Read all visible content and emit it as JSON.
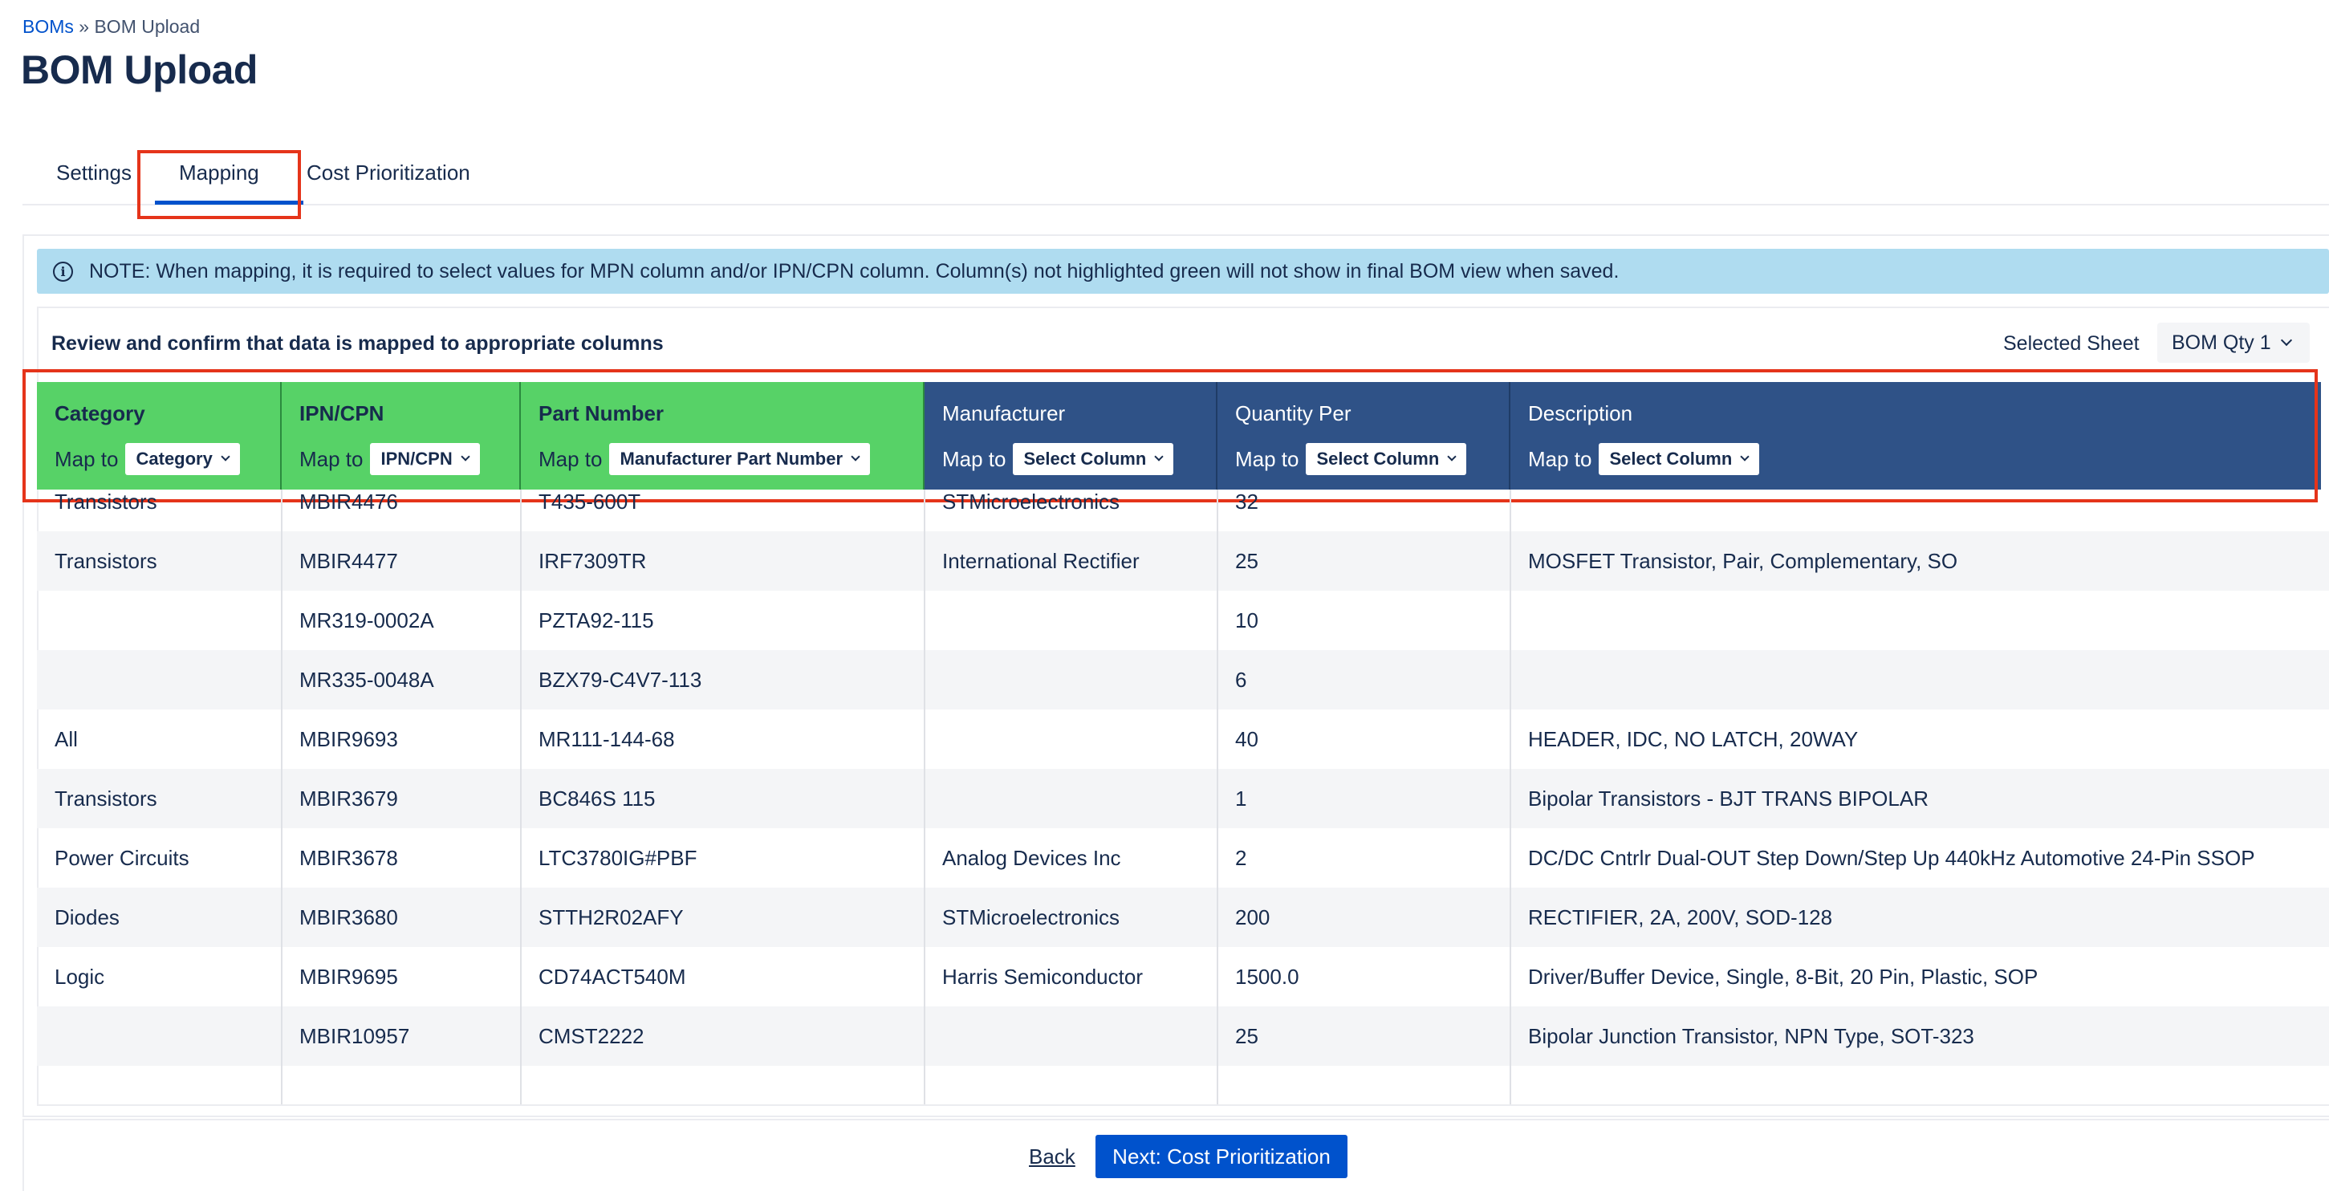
{
  "breadcrumb": {
    "parent": "BOMs",
    "separator": "»",
    "current": "BOM Upload"
  },
  "page_title": "BOM Upload",
  "tabs": [
    {
      "label": "Settings"
    },
    {
      "label": "Mapping",
      "active": true
    },
    {
      "label": "Cost Prioritization"
    }
  ],
  "note": {
    "icon": "info-icon",
    "text": "NOTE: When mapping, it is required to select values for MPN column and/or IPN/CPN column. Column(s) not highlighted green will not show in final BOM view when saved."
  },
  "review_text": "Review and confirm that data is mapped to appropriate columns",
  "sheet": {
    "label": "Selected Sheet",
    "value": "BOM Qty 1"
  },
  "map_to_label": "Map to",
  "columns": [
    {
      "name": "Category",
      "map": "Category",
      "state": "green"
    },
    {
      "name": "IPN/CPN",
      "map": "IPN/CPN",
      "state": "green"
    },
    {
      "name": "Part Number",
      "map": "Manufacturer Part Number",
      "state": "green"
    },
    {
      "name": "Manufacturer",
      "map": "Select Column",
      "state": "blue"
    },
    {
      "name": "Quantity Per",
      "map": "Select Column",
      "state": "blue"
    },
    {
      "name": "Description",
      "map": "Select Column",
      "state": "blue"
    }
  ],
  "rows": [
    [
      "Transistors",
      "MBIR4476",
      "T435-600T",
      "STMicroelectronics",
      "32",
      ""
    ],
    [
      "Transistors",
      "MBIR4477",
      "IRF7309TR",
      "International Rectifier",
      "25",
      "MOSFET Transistor, Pair, Complementary, SO"
    ],
    [
      "",
      "MR319-0002A",
      "PZTA92-115",
      "",
      "10",
      ""
    ],
    [
      "",
      "MR335-0048A",
      "BZX79-C4V7-113",
      "",
      "6",
      ""
    ],
    [
      "All",
      "MBIR9693",
      "MR111-144-68",
      "",
      "40",
      "HEADER, IDC, NO LATCH, 20WAY"
    ],
    [
      "Transistors",
      "MBIR3679",
      "BC846S 115",
      "",
      "1",
      "Bipolar Transistors - BJT TRANS BIPOLAR"
    ],
    [
      "Power Circuits",
      "MBIR3678",
      "LTC3780IG#PBF",
      "Analog Devices Inc",
      "2",
      "DC/DC Cntrlr Dual-OUT Step Down/Step Up 440kHz Automotive 24-Pin SSOP"
    ],
    [
      "Diodes",
      "MBIR3680",
      "STTH2R02AFY",
      "STMicroelectronics",
      "200",
      "RECTIFIER, 2A, 200V, SOD-128"
    ],
    [
      "Logic",
      "MBIR9695",
      "CD74ACT540M",
      "Harris Semiconductor",
      "1500.0",
      "Driver/Buffer Device, Single, 8-Bit, 20 Pin, Plastic, SOP"
    ],
    [
      "",
      "MBIR10957",
      "CMST2222",
      "",
      "25",
      "Bipolar Junction Transistor, NPN Type, SOT-323"
    ]
  ],
  "footer": {
    "back_label": "Back",
    "next_label": "Next: Cost Prioritization"
  },
  "colors": {
    "mapped": "#57d267",
    "unmapped": "#2f5287",
    "primary": "#0052cc",
    "highlight": "#e5341a",
    "note_bg": "#afdcf0"
  }
}
